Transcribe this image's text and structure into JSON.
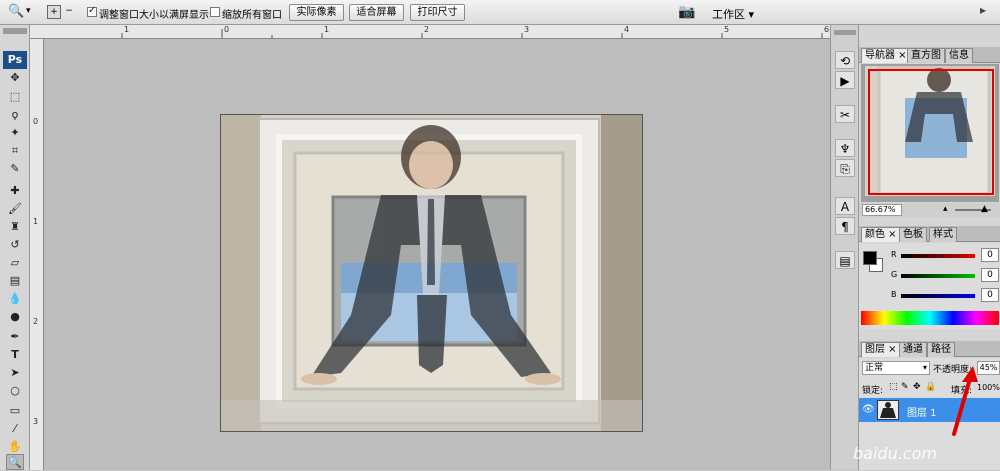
{
  "options_bar": {
    "zoom_tool_icon": "magnifier-icon",
    "fit_window_label": "调整窗口大小以满屏显示",
    "fit_window_checked": true,
    "zoom_all_label": "缩放所有窗口",
    "zoom_all_checked": false,
    "actual_pixels": "实际像素",
    "fit_screen": "适合屏幕",
    "print_size": "打印尺寸",
    "workspace": "工作区"
  },
  "ruler": {
    "h_ticks": [
      "1",
      "0",
      "1",
      "2",
      "3",
      "4",
      "5",
      "6",
      "7"
    ],
    "v_ticks": [
      "0",
      "1",
      "2",
      "3"
    ]
  },
  "navigator": {
    "tabs": [
      "导航器",
      "直方图",
      "信息"
    ],
    "zoom": "66.67%"
  },
  "color": {
    "tabs": [
      "颜色",
      "色板",
      "样式"
    ],
    "channels": [
      {
        "name": "R",
        "value": "0",
        "color": "#d40000"
      },
      {
        "name": "G",
        "value": "0",
        "color": "#00a000"
      },
      {
        "name": "B",
        "value": "0",
        "color": "#0000c8"
      }
    ],
    "foreground": "#000000",
    "background": "#ffffff"
  },
  "layers": {
    "tabs": [
      "图层",
      "通道",
      "路径"
    ],
    "blend_mode": "正常",
    "opacity_label": "不透明度:",
    "opacity": "45%",
    "lock_label": "锁定:",
    "fill_label": "填充:",
    "fill": "100%",
    "layer_name": "图层 1"
  },
  "watermark": "baidu.com",
  "ps_logo": "Ps"
}
